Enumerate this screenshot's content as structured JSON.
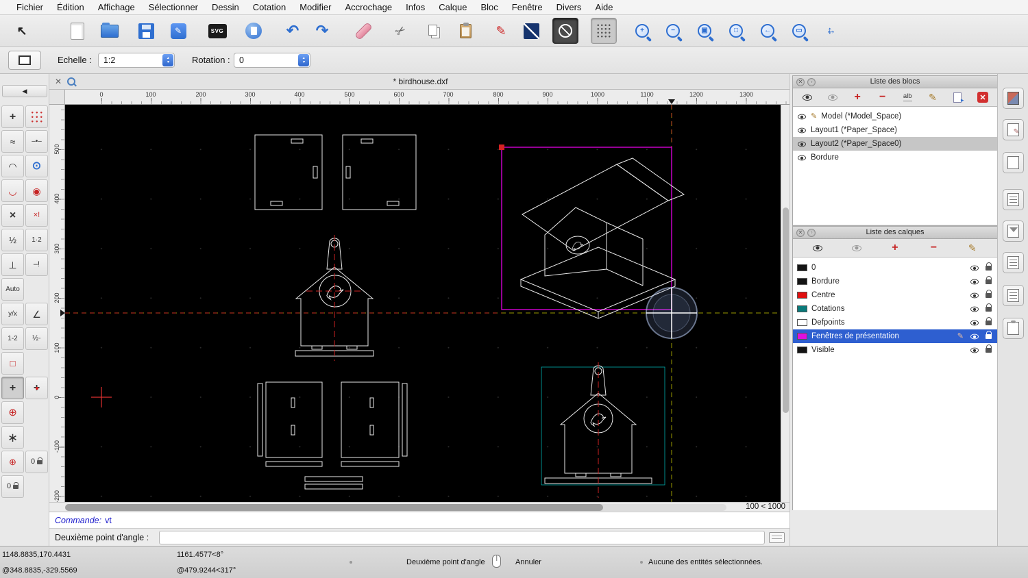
{
  "colors": {
    "accent_blue": "#2f6fd0",
    "selection_blue": "#2e5fd0",
    "viewport_magenta": "#d400d4",
    "centerline_red": "#cc2222",
    "dimension_teal": "#00b0b0",
    "construction_yellow": "#9d9d00",
    "canvas_black": "#000000"
  },
  "menu_bar": {
    "items": [
      "Fichier",
      "Édition",
      "Affichage",
      "Sélectionner",
      "Dessin",
      "Cotation",
      "Modifier",
      "Accrochage",
      "Infos",
      "Calque",
      "Bloc",
      "Fenêtre",
      "Divers",
      "Aide"
    ]
  },
  "toolbar": {
    "svg_label": "SVG",
    "icons": [
      "select-arrow-icon",
      "new-file-icon",
      "open-folder-icon",
      "save-icon",
      "drawing-preferences-icon",
      "svg-export-icon",
      "print-preview-icon",
      "undo-icon",
      "redo-icon",
      "delete-eraser-icon",
      "cut-scissors-icon",
      "copy-icon",
      "paste-clipboard-icon",
      "edit-pen-icon",
      "line-tool-icon",
      "circle-tool-icon",
      "grid-toggle-icon",
      "zoom-in-icon",
      "zoom-out-icon",
      "auto-zoom-icon",
      "zoom-selection-icon",
      "previous-view-icon",
      "zoom-window-icon",
      "pan-icon"
    ]
  },
  "options_bar": {
    "scale_label": "Echelle :",
    "scale_value": "1:2",
    "rotation_label": "Rotation :",
    "rotation_value": "0",
    "stepper_up": "▴",
    "stepper_down": "▾"
  },
  "snap_palette": {
    "collapse_glyph": "◀",
    "auto_label": "Auto",
    "yx_label": "y/x",
    "icons": [
      "snap-free",
      "snap-grid",
      "snap-endpoint",
      "snap-on-entity",
      "snap-arc-center",
      "snap-circle-center",
      "snap-tangent",
      "snap-reference-point",
      "snap-intersection",
      "snap-intersection-manual",
      "snap-middle",
      "snap-distance",
      "restrict-orthogonal",
      "restrict-nothing",
      "snap-auto",
      "set-relative-zero",
      "angle-snap",
      "half-point",
      "distance-point",
      "restrict-horizontal",
      "relative-zero",
      "crosshair-snap",
      "circle-center-plus",
      "construction-rays",
      "lock-relative-zero",
      "zero-lock",
      "zero-lock-2"
    ]
  },
  "document": {
    "title": "* birdhouse.dxf",
    "h_ruler": [
      "0",
      "100",
      "200",
      "300",
      "400",
      "500",
      "600",
      "700",
      "800",
      "900",
      "1000",
      "1100",
      "1200",
      "1300"
    ],
    "v_ruler": [
      "500",
      "400",
      "300",
      "200",
      "100",
      "0",
      "-100",
      "-200"
    ],
    "zoom_status": "100 < 1000"
  },
  "command_line": {
    "history_label": "Commande:",
    "history_value": "vt",
    "prompt_label": "Deuxième point d'angle :",
    "input_value": ""
  },
  "status_bar": {
    "abs_coord": "1148.8835,170.4431",
    "rel_coord": "@348.8835,-329.5569",
    "abs_polar": "1161.4577<8°",
    "rel_polar": "@479.9244<317°",
    "action_hint": "Deuxième point d'angle",
    "cancel_hint": "Annuler",
    "selection_status": "Aucune des entités sélectionnées."
  },
  "blocks_panel": {
    "title": "Liste des blocs",
    "rename_label": "alb",
    "toolbar_icons": [
      "show-all-blocks-eye",
      "hide-all-blocks-eye",
      "add-block-plus",
      "remove-block-minus",
      "rename-block",
      "edit-block-pencil",
      "insert-block-page",
      "delete-block-x"
    ],
    "items": [
      {
        "label": "Model (*Model_Space)",
        "selected": false,
        "editing": true
      },
      {
        "label": "Layout1 (*Paper_Space)",
        "selected": false,
        "editing": false
      },
      {
        "label": "Layout2 (*Paper_Space0)",
        "selected": true,
        "editing": false
      },
      {
        "label": "Bordure",
        "selected": false,
        "editing": false
      }
    ]
  },
  "layers_panel": {
    "title": "Liste des calques",
    "toolbar_icons": [
      "show-all-layers-eye",
      "hide-all-layers-eye",
      "add-layer-plus",
      "remove-layer-minus",
      "edit-layer-pencil"
    ],
    "items": [
      {
        "label": "0",
        "color": "#141414",
        "selected": false
      },
      {
        "label": "Bordure",
        "color": "#141414",
        "selected": false
      },
      {
        "label": "Centre",
        "color": "#e01010",
        "selected": false
      },
      {
        "label": "Cotations",
        "color": "#0a7a7a",
        "selected": false
      },
      {
        "label": "Defpoints",
        "color": "#ffffff",
        "selected": false
      },
      {
        "label": "Fenêtres de présentation",
        "color": "#e010e0",
        "selected": true
      },
      {
        "label": "Visible",
        "color": "#141414",
        "selected": false
      }
    ]
  },
  "side_strip": {
    "icons": [
      "blocks-list-toggle",
      "layers-list-toggle",
      "views-list-toggle",
      "library-browser-toggle",
      "command-widget-toggle",
      "property-editor-toggle",
      "selection-filter-toggle",
      "clipboard-panel-toggle"
    ]
  }
}
